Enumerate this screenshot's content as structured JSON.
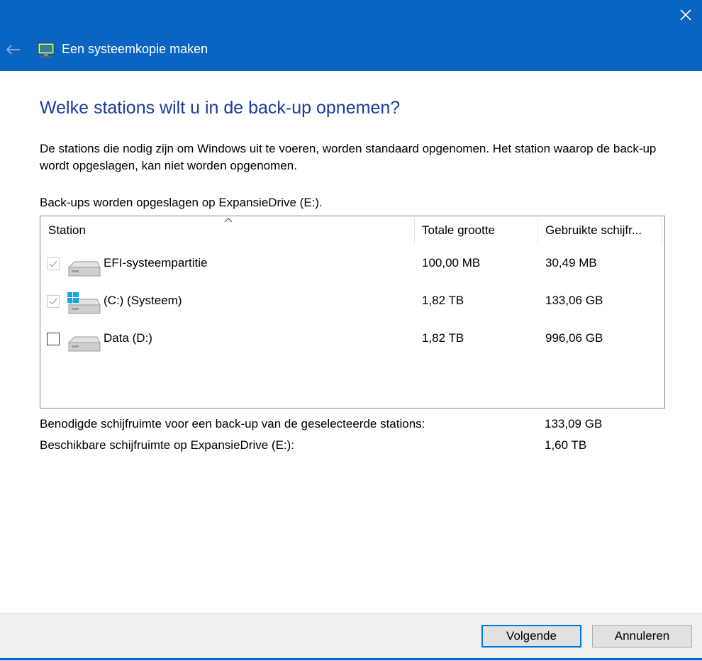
{
  "window": {
    "title": "Een systeemkopie maken",
    "accent_color": "#0a64c2",
    "icons": {
      "close": "close-icon",
      "back": "back-arrow-icon",
      "app": "system-image-backup-icon"
    }
  },
  "page": {
    "heading": "Welke stations wilt u in de back-up opnemen?",
    "description": "De stations die nodig zijn om Windows uit te voeren, worden standaard opgenomen. Het station waarop de back-up wordt opgeslagen, kan niet worden opgenomen.",
    "saved_on": "Back-ups worden opgeslagen op ExpansieDrive (E:)."
  },
  "table": {
    "columns": [
      "Station",
      "Totale grootte",
      "Gebruikte schijfr..."
    ],
    "rows": [
      {
        "name": "EFI-systeempartitie",
        "total": "100,00 MB",
        "used": "30,49 MB",
        "checked": true,
        "enabled": false,
        "icon": "drive-icon"
      },
      {
        "name": "(C:) (Systeem)",
        "total": "1,82 TB",
        "used": "133,06 GB",
        "checked": true,
        "enabled": false,
        "icon": "windows-drive-icon"
      },
      {
        "name": "Data (D:)",
        "total": "1,82 TB",
        "used": "996,06 GB",
        "checked": false,
        "enabled": true,
        "icon": "drive-icon"
      }
    ]
  },
  "summary": {
    "required_label": "Benodigde schijfruimte voor een back-up van de geselecteerde stations:",
    "required_value": "133,09 GB",
    "available_label": "Beschikbare schijfruimte op ExpansieDrive (E:):",
    "available_value": "1,60 TB"
  },
  "buttons": {
    "next": "Volgende",
    "cancel": "Annuleren"
  }
}
